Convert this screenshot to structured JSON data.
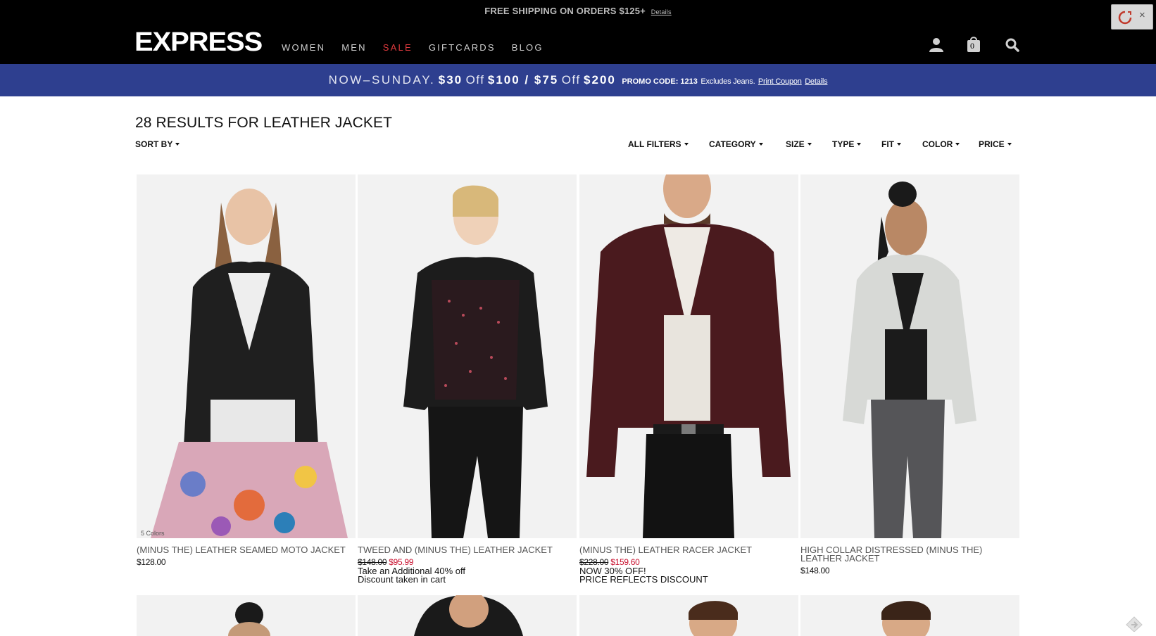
{
  "header": {
    "shipping_text": "FREE SHIPPING ON ORDERS $125+",
    "shipping_details": "Details",
    "logo": "EXPRESS",
    "nav": [
      "WOMEN",
      "MEN",
      "SALE",
      "GIFTCARDS",
      "BLOG"
    ],
    "bag_count": "0",
    "icons": [
      "user-icon",
      "bag-icon",
      "search-icon"
    ],
    "extension_close": "×"
  },
  "promo": {
    "lead": "NOW–SUNDAY.",
    "amount1": "$30",
    "off1": "Off",
    "threshold1": "$100 / $75",
    "off2": "Off",
    "threshold2": "$200",
    "code": "PROMO CODE: 1213",
    "exclusion": "Excludes Jeans.",
    "print": "Print Coupon",
    "details": "Details"
  },
  "results": {
    "title": "28 RESULTS FOR LEATHER JACKET",
    "sort_by": "SORT BY"
  },
  "filters": [
    "ALL FILTERS",
    "CATEGORY",
    "SIZE",
    "TYPE",
    "FIT",
    "COLOR",
    "PRICE"
  ],
  "products": [
    {
      "name": "(MINUS THE) LEATHER SEAMED MOTO JACKET",
      "price": "$128.00",
      "note": "5 Colors"
    },
    {
      "name": "TWEED AND (MINUS THE) LEATHER JACKET",
      "original_price": "$148.00",
      "sale_price": "$95.99",
      "promo_line1": "Take an Additional 40% off",
      "promo_line2": "Discount taken in cart"
    },
    {
      "name": "(MINUS THE) LEATHER RACER JACKET",
      "original_price": "$228.00",
      "sale_price": "$159.60",
      "promo_line1": "NOW 30% OFF!",
      "promo_line2": "PRICE REFLECTS DISCOUNT"
    },
    {
      "name": "HIGH COLLAR DISTRESSED (MINUS THE) LEATHER JACKET",
      "price": "$148.00"
    }
  ],
  "colors": {
    "header_bg": "#000000",
    "promo_bg": "#2e3f8f",
    "sale_red": "#c8102e",
    "nav_sale": "#e03a3e"
  }
}
